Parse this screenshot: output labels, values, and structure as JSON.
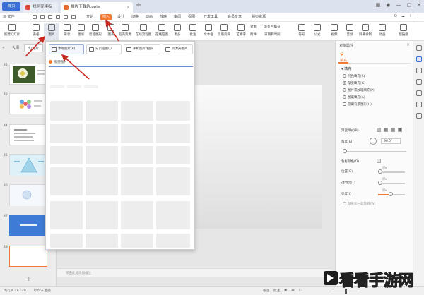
{
  "titlebar": {
    "home": "首页",
    "tabs": [
      {
        "label": "找稻壳模板",
        "icon": "docer-icon",
        "color": "#e0453a"
      },
      {
        "label": "相片下载站.pptx",
        "icon": "ppt-icon",
        "color": "#e56a2d"
      }
    ],
    "new_tab": "+"
  },
  "menubar": {
    "file_label": "三 文件",
    "items": [
      "开始",
      "插入",
      "设计",
      "切换",
      "动画",
      "放映",
      "审阅",
      "视图",
      "开发工具",
      "会员专享",
      "稻壳资源"
    ],
    "highlight": "插入",
    "search_placeholder": "Q"
  },
  "ribbon": {
    "buttons": [
      "新建幻灯片",
      "表格",
      "图片",
      "形状",
      "图标",
      "智能图形",
      "图表",
      "稻壳资源",
      "在线流程图",
      "在线脑图",
      "更多",
      "批注",
      "文本框",
      "页眉页脚",
      "艺术字",
      "符号",
      "公式",
      "视频",
      "音频",
      "屏幕录制",
      "动画",
      "超链接"
    ],
    "small": [
      "对象",
      "幻灯片编号",
      "附件",
      "日期和时间"
    ]
  },
  "leftpane": {
    "tabs": [
      "大纲",
      "幻灯片"
    ],
    "slide_numbers": [
      "42",
      "43",
      "44",
      "45",
      "46",
      "47",
      "48"
    ]
  },
  "dropdown": {
    "options": [
      "本地图片(P)",
      "分页插图(I)",
      "手机图片/拍照",
      "资源夹图片"
    ],
    "sub": "稻壳图片"
  },
  "notes": "单击此处添加备注",
  "rightpane": {
    "title": "对象属性",
    "tab": "填充",
    "section": "填充",
    "fill_options": [
      "纯色填充(S)",
      "渐变填充(G)",
      "图片或纹理填充(P)",
      "图案填充(A)",
      "隐藏背景图形(H)"
    ],
    "gradient_label": "渐变样式(R)",
    "angle_label": "角度(E)",
    "angle_value": "90.0°",
    "stops_label": "色标颜色(O)",
    "position_label": "位置(O)",
    "transparency_label": "透明度(T)",
    "brightness_label": "亮度(I)",
    "position_value": "0%",
    "transparency_value": "0%",
    "brightness_value": "0%",
    "align_label": "与形状一起旋转(W)"
  },
  "statusbar": {
    "slide_info": "幻灯片 48 / 48",
    "theme": "Office 主题",
    "right_items": [
      "备注",
      "批注"
    ]
  },
  "watermark": "看看手游网"
}
